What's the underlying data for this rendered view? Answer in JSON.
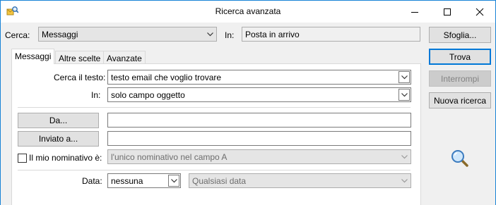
{
  "window": {
    "title": "Ricerca avanzata",
    "app_icon": "outlook-search-icon"
  },
  "search_bar": {
    "cerca_label": "Cerca:",
    "cerca_value": "Messaggi",
    "in_label": "In:",
    "in_value": "Posta in arrivo",
    "sfoglia_label": "Sfoglia..."
  },
  "tabs": [
    {
      "label": "Messaggi",
      "active": true
    },
    {
      "label": "Altre scelte",
      "active": false
    },
    {
      "label": "Avanzate",
      "active": false
    }
  ],
  "messaggi_tab": {
    "search_text_label": "Cerca il testo:",
    "search_text_value": "testo email che voglio trovare",
    "in_label": "In:",
    "in_value": "solo campo oggetto",
    "from_button": "Da...",
    "from_value": "",
    "sent_to_button": "Inviato a...",
    "sent_to_value": "",
    "my_name_checkbox_label": "Il mio nominativo è:",
    "my_name_checked": false,
    "my_name_value": "l'unico nominativo nel campo A",
    "date_label": "Data:",
    "date_value": "nessuna",
    "date_range_value": "Qualsiasi data"
  },
  "side_buttons": {
    "find": "Trova",
    "stop": "Interrompi",
    "new_search": "Nuova ricerca"
  },
  "colors": {
    "accent": "#0078d7",
    "window_border": "#1883d7"
  }
}
